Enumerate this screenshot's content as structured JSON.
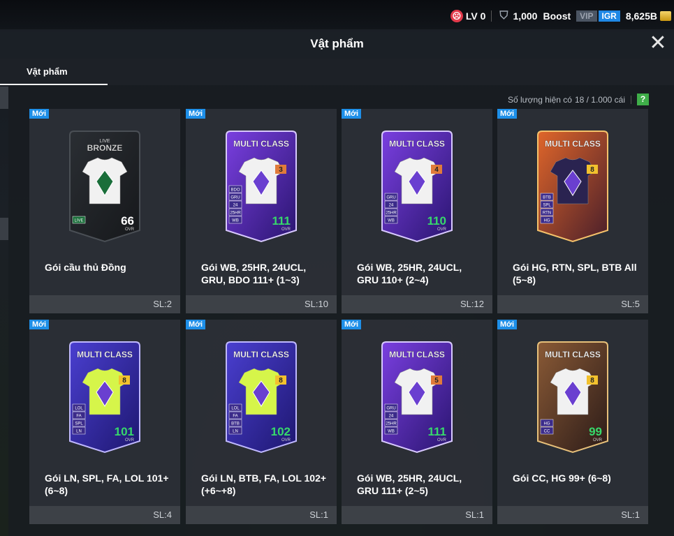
{
  "topbar": {
    "level": "LV 0",
    "shield_value": "1,000",
    "boost_label": "Boost",
    "vip_label": "VIP",
    "igr_label": "IGR",
    "coins": "8,625B"
  },
  "header": {
    "title": "Vật phẩm"
  },
  "tabs": [
    {
      "label": "Vật phẩm",
      "active": true
    }
  ],
  "inventory": {
    "count_label": "Số lượng hiện có",
    "count_value": "18 / 1.000 cái",
    "help_label": "?"
  },
  "items": [
    {
      "badge": "Mới",
      "name": "Gói cầu thủ Đồng",
      "qty": "SL:2",
      "card_title": "BRONZE",
      "card_top": "LIVE",
      "ovr": "66",
      "ovr_label": "OVR",
      "style": "bronze",
      "rank": "",
      "chips": [
        "LIVE"
      ]
    },
    {
      "badge": "Mới",
      "name": "Gói WB, 25HR, 24UCL, GRU, BDO 111+ (1~3)",
      "qty": "SL:10",
      "card_title": "MULTI CLASS",
      "ovr": "111",
      "ovr_label": "OVR",
      "style": "purple",
      "rank": "3",
      "chips": [
        "BDO",
        "GRU",
        "24",
        "25HR",
        "WB"
      ]
    },
    {
      "badge": "Mới",
      "name": "Gói WB, 25HR, 24UCL, GRU 110+ (2~4)",
      "qty": "SL:12",
      "card_title": "MULTI CLASS",
      "ovr": "110",
      "ovr_label": "OVR",
      "style": "purple",
      "rank": "4",
      "chips": [
        "GRU",
        "24",
        "25HR",
        "WB"
      ]
    },
    {
      "badge": "Mới",
      "name": "Gói HG, RTN, SPL, BTB All (5~8)",
      "qty": "SL:5",
      "card_title": "MULTI CLASS",
      "ovr": "",
      "ovr_label": "",
      "style": "orange",
      "rank": "8",
      "chips": [
        "BTB",
        "SPL",
        "RTN",
        "HG"
      ]
    },
    {
      "badge": "Mới",
      "name": "Gói LN, SPL, FA, LOL 101+ (6~8)",
      "qty": "SL:4",
      "card_title": "MULTI CLASS",
      "ovr": "101",
      "ovr_label": "OVR",
      "style": "lime",
      "rank": "8",
      "chips": [
        "LOL",
        "FA",
        "SPL",
        "LN"
      ]
    },
    {
      "badge": "Mới",
      "name": "Gói LN, BTB, FA, LOL 102+ (+6~+8)",
      "qty": "SL:1",
      "card_title": "MULTI CLASS",
      "ovr": "102",
      "ovr_label": "OVR",
      "style": "lime",
      "rank": "8",
      "chips": [
        "LOL",
        "FA",
        "BTB",
        "LN"
      ]
    },
    {
      "badge": "Mới",
      "name": "Gói WB, 25HR, 24UCL, GRU 111+ (2~5)",
      "qty": "SL:1",
      "card_title": "MULTI CLASS",
      "ovr": "111",
      "ovr_label": "OVR",
      "style": "purple",
      "rank": "5",
      "chips": [
        "GRU",
        "24",
        "25HR",
        "WB"
      ]
    },
    {
      "badge": "Mới",
      "name": "Gói CC, HG 99+ (6~8)",
      "qty": "SL:1",
      "card_title": "MULTI CLASS",
      "ovr": "99",
      "ovr_label": "OVR",
      "style": "gold",
      "rank": "8",
      "chips": [
        "HG",
        "CC"
      ]
    }
  ],
  "colors": {
    "badge_new": "#1e8fe8",
    "ovr_green": "#37d96b",
    "rank_orange": "#e07b3a",
    "rank_gold": "#f2c12e"
  }
}
